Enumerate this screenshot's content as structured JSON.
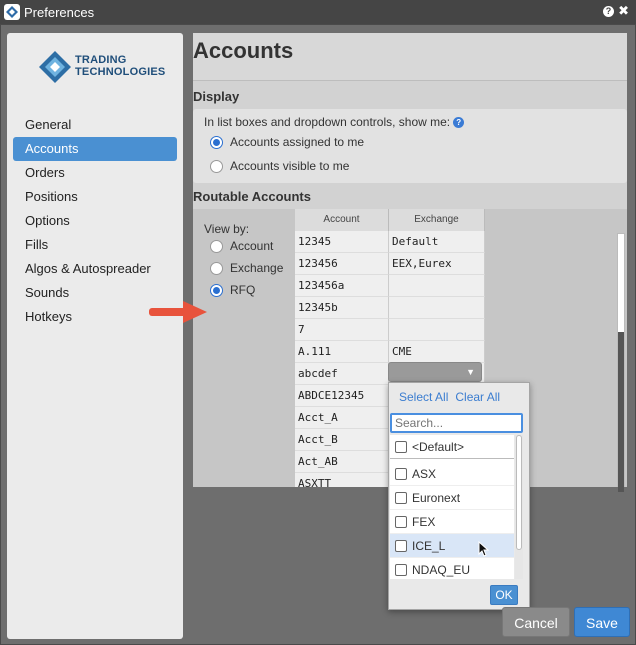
{
  "window": {
    "title": "Preferences",
    "help_glyph": "?",
    "close_glyph": "✖"
  },
  "sidebar": {
    "logo_line1": "TRADING",
    "logo_line2": "TECHNOLOGIES",
    "items": [
      {
        "label": "General"
      },
      {
        "label": "Accounts"
      },
      {
        "label": "Orders"
      },
      {
        "label": "Positions"
      },
      {
        "label": "Options"
      },
      {
        "label": "Fills"
      },
      {
        "label": "Algos & Autospreader"
      },
      {
        "label": "Sounds"
      },
      {
        "label": "Hotkeys"
      }
    ],
    "active_index": 1
  },
  "main": {
    "title": "Accounts",
    "display": {
      "header": "Display",
      "prompt": "In list boxes and dropdown controls, show me:",
      "info_glyph": "?",
      "options": [
        {
          "label": "Accounts assigned to me",
          "selected": true
        },
        {
          "label": "Accounts visible to me",
          "selected": false
        }
      ]
    },
    "routable": {
      "header": "Routable Accounts",
      "view_by_label": "View by:",
      "view_by_options": [
        {
          "label": "Account",
          "selected": false
        },
        {
          "label": "Exchange",
          "selected": false
        },
        {
          "label": "RFQ",
          "selected": true
        }
      ],
      "columns": [
        "Account",
        "Exchange"
      ],
      "rows": [
        [
          "12345",
          "Default"
        ],
        [
          "123456",
          "EEX,Eurex"
        ],
        [
          "123456a",
          ""
        ],
        [
          "12345b",
          ""
        ],
        [
          "7",
          ""
        ],
        [
          "A.111",
          "CME"
        ],
        [
          "abcdef",
          ""
        ],
        [
          "ABDCE12345",
          ""
        ],
        [
          "Acct_A",
          ""
        ],
        [
          "Acct_B",
          ""
        ],
        [
          "Act_AB",
          ""
        ],
        [
          "ASXTT",
          ""
        ]
      ]
    }
  },
  "dropdown": {
    "chevron_glyph": "▼",
    "select_all": "Select All",
    "clear_all": "Clear All",
    "search_placeholder": "Search...",
    "items": [
      {
        "label": "<Default>",
        "checked": false
      },
      {
        "label": "ASX",
        "checked": false
      },
      {
        "label": "Euronext",
        "checked": false
      },
      {
        "label": "FEX",
        "checked": false
      },
      {
        "label": "ICE_L",
        "checked": false,
        "hover": true
      },
      {
        "label": "NDAQ_EU",
        "checked": false
      }
    ],
    "ok_label": "OK"
  },
  "footer": {
    "cancel_label": "Cancel",
    "save_label": "Save"
  },
  "colors": {
    "accent": "#4a90d2",
    "arrow": "#e8533c"
  }
}
